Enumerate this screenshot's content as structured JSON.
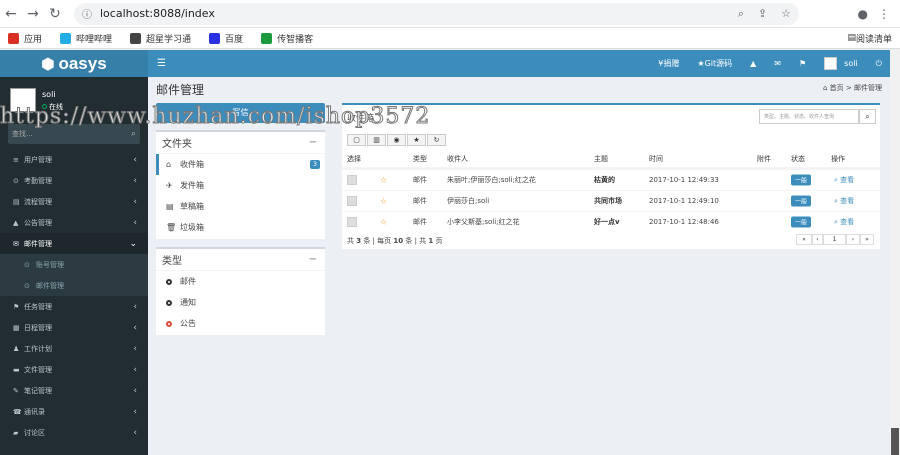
{
  "browser": {
    "url": "localhost:8088/index",
    "bookmarks": [
      {
        "label": "应用",
        "color": "#d93025"
      },
      {
        "label": "哔哩哔哩",
        "color": "#23ade5"
      },
      {
        "label": "超星学习通",
        "color": "#444444"
      },
      {
        "label": "百度",
        "color": "#2932e1"
      },
      {
        "label": "传智播客",
        "color": "#1a9a3c"
      }
    ],
    "reading_list": "阅读清单"
  },
  "app": {
    "logo": "oasys",
    "top_links": [
      "¥捐赠",
      "★Git源码"
    ],
    "username": "soli"
  },
  "sidebar": {
    "user_name": "soli",
    "status": "在线",
    "search_placeholder": "查找...",
    "items": [
      {
        "label": "用户管理",
        "icon": "≡"
      },
      {
        "label": "考勤管理",
        "icon": "⊙"
      },
      {
        "label": "流程管理",
        "icon": "▤"
      },
      {
        "label": "公告管理",
        "icon": "▲"
      },
      {
        "label": "邮件管理",
        "icon": "✉"
      },
      {
        "label": "任务管理",
        "icon": "⚑"
      },
      {
        "label": "日程管理",
        "icon": "▦"
      },
      {
        "label": "工作计划",
        "icon": "♟"
      },
      {
        "label": "文件管理",
        "icon": "▬"
      },
      {
        "label": "笔记管理",
        "icon": "✎"
      },
      {
        "label": "通讯录",
        "icon": "☎"
      },
      {
        "label": "讨论区",
        "icon": "▰"
      }
    ],
    "sub_items": [
      "账号管理",
      "邮件管理"
    ]
  },
  "page": {
    "title": "邮件管理",
    "breadcrumb_home": "首页",
    "breadcrumb_current": "邮件管理",
    "compose_label": "写信"
  },
  "folders": {
    "title": "文件夹",
    "items": [
      {
        "label": "收件箱",
        "icon": "⌂",
        "count": "3"
      },
      {
        "label": "发件箱",
        "icon": "✈",
        "count": ""
      },
      {
        "label": "草稿箱",
        "icon": "▤",
        "count": ""
      },
      {
        "label": "垃圾箱",
        "icon": "🗑",
        "count": ""
      }
    ]
  },
  "types": {
    "title": "类型",
    "items": [
      {
        "label": "邮件",
        "color": "#333333"
      },
      {
        "label": "通知",
        "color": "#333333"
      },
      {
        "label": "公告",
        "color": "#dd4b39"
      }
    ]
  },
  "inbox": {
    "title": "收件箱",
    "search_placeholder": "类型、主题、状态、收件人查询",
    "columns": [
      "选择",
      "类型",
      "收件人",
      "主题",
      "时间",
      "附件",
      "状态",
      "操作"
    ],
    "rows": [
      {
        "type": "邮件",
        "recipients": "朱丽叶;伊丽莎白;soli;红之花",
        "subject": "枯黄的",
        "time": "2017-10-1 12:49:33",
        "attachment": "",
        "status": "一般",
        "action": "查看"
      },
      {
        "type": "邮件",
        "recipients": "伊丽莎白;soli",
        "subject": "共同市场",
        "time": "2017-10-1 12:49:10",
        "attachment": "",
        "status": "一般",
        "action": "查看"
      },
      {
        "type": "邮件",
        "recipients": "小李父斯基;soli;红之花",
        "subject": "好一点v",
        "time": "2017-10-1 12:48:46",
        "attachment": "",
        "status": "一般",
        "action": "查看"
      }
    ],
    "footer": {
      "pre": "共 ",
      "total": "3",
      "mid1": " 条 | 每页 ",
      "per_page": "10",
      "mid2": " 条 | 共 ",
      "pages": "1",
      "post": " 页"
    },
    "page_input": "1"
  },
  "watermark": "https://www.huzhan.com/ishop3572"
}
